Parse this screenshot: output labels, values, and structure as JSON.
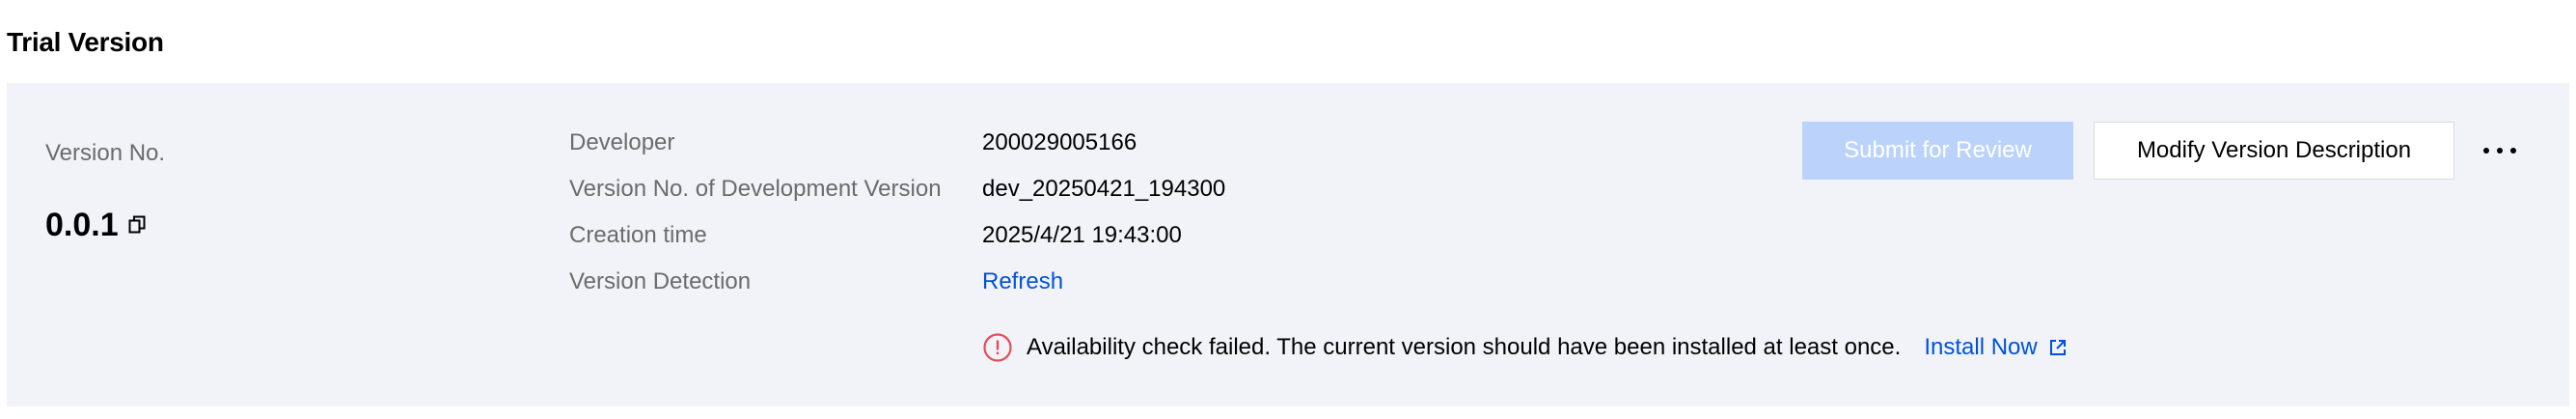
{
  "section": {
    "title": "Trial Version"
  },
  "version": {
    "label": "Version No.",
    "value": "0.0.1"
  },
  "details": [
    {
      "label": "Developer",
      "value": "200029005166"
    },
    {
      "label": "Version No. of Development Version",
      "value": "dev_20250421_194300"
    },
    {
      "label": "Creation time",
      "value": "2025/4/21 19:43:00"
    },
    {
      "label": "Version Detection",
      "value": "Refresh"
    }
  ],
  "alert": {
    "icon": "error-circle-icon",
    "message": "Availability check failed. The current version should have been installed at least once.",
    "link_label": "Install Now",
    "link_icon": "external-link-icon"
  },
  "actions": {
    "submit_label": "Submit for Review",
    "submit_disabled": true,
    "modify_label": "Modify Version Description",
    "more_icon": "more-horizontal-icon"
  },
  "colors": {
    "card_bg": "#f2f3f8",
    "link": "#0052d9",
    "disabled_primary_bg": "#bbd3fb",
    "error": "#e34d59",
    "label_text": "#6b6b6b"
  }
}
